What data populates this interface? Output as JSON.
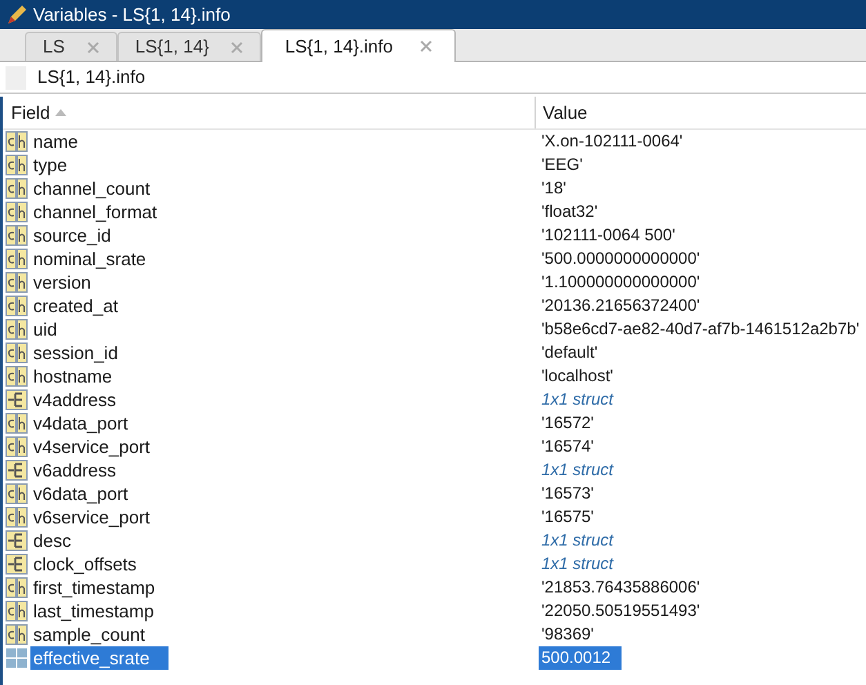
{
  "window": {
    "title": "Variables - LS{1, 14}.info"
  },
  "tabs": [
    {
      "label": "LS",
      "selected": false
    },
    {
      "label": "LS{1, 14}",
      "selected": false
    },
    {
      "label": "LS{1, 14}.info",
      "selected": true
    }
  ],
  "path": "LS{1, 14}.info",
  "table": {
    "columns": [
      "Field",
      "Value"
    ],
    "rows": [
      {
        "kind": "char",
        "field": "name",
        "value": "'X.on-102111-0064'",
        "selected": false
      },
      {
        "kind": "char",
        "field": "type",
        "value": "'EEG'",
        "selected": false
      },
      {
        "kind": "char",
        "field": "channel_count",
        "value": "'18'",
        "selected": false
      },
      {
        "kind": "char",
        "field": "channel_format",
        "value": "'float32'",
        "selected": false
      },
      {
        "kind": "char",
        "field": "source_id",
        "value": "'102111-0064 500'",
        "selected": false
      },
      {
        "kind": "char",
        "field": "nominal_srate",
        "value": "'500.0000000000000'",
        "selected": false
      },
      {
        "kind": "char",
        "field": "version",
        "value": "'1.100000000000000'",
        "selected": false
      },
      {
        "kind": "char",
        "field": "created_at",
        "value": "'20136.21656372400'",
        "selected": false
      },
      {
        "kind": "char",
        "field": "uid",
        "value": "'b58e6cd7-ae82-40d7-af7b-1461512a2b7b'",
        "selected": false
      },
      {
        "kind": "char",
        "field": "session_id",
        "value": "'default'",
        "selected": false
      },
      {
        "kind": "char",
        "field": "hostname",
        "value": "'localhost'",
        "selected": false
      },
      {
        "kind": "struct",
        "field": "v4address",
        "value": "1x1 struct",
        "selected": false
      },
      {
        "kind": "char",
        "field": "v4data_port",
        "value": "'16572'",
        "selected": false
      },
      {
        "kind": "char",
        "field": "v4service_port",
        "value": "'16574'",
        "selected": false
      },
      {
        "kind": "struct",
        "field": "v6address",
        "value": "1x1 struct",
        "selected": false
      },
      {
        "kind": "char",
        "field": "v6data_port",
        "value": "'16573'",
        "selected": false
      },
      {
        "kind": "char",
        "field": "v6service_port",
        "value": "'16575'",
        "selected": false
      },
      {
        "kind": "struct",
        "field": "desc",
        "value": "1x1 struct",
        "selected": false
      },
      {
        "kind": "struct",
        "field": "clock_offsets",
        "value": "1x1 struct",
        "selected": false
      },
      {
        "kind": "char",
        "field": "first_timestamp",
        "value": "'21853.76435886006'",
        "selected": false
      },
      {
        "kind": "char",
        "field": "last_timestamp",
        "value": "'22050.50519551493'",
        "selected": false
      },
      {
        "kind": "char",
        "field": "sample_count",
        "value": "'98369'",
        "selected": false
      },
      {
        "kind": "double",
        "field": "effective_srate",
        "value": "500.0012",
        "selected": true
      }
    ]
  }
}
